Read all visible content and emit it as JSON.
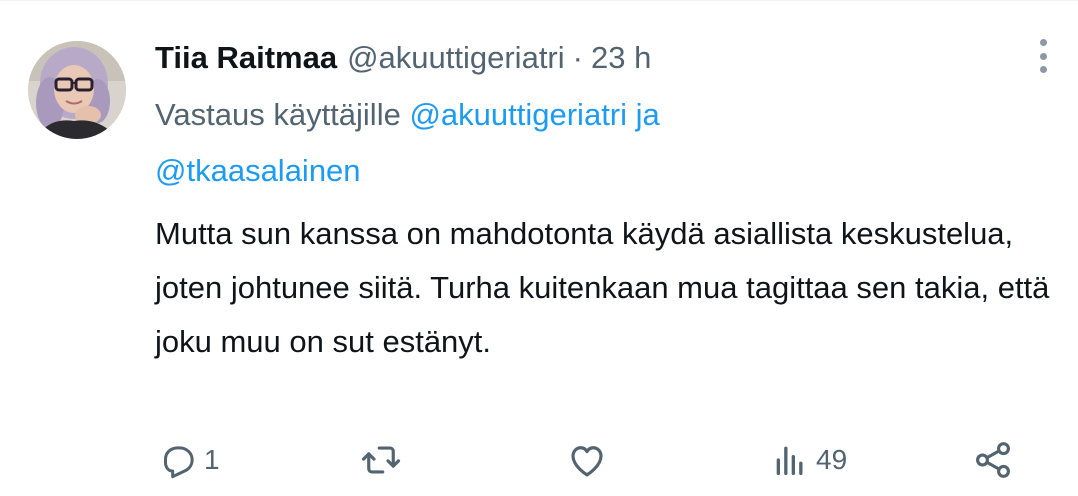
{
  "tweet": {
    "display_name": "Tiia Raitmaa",
    "handle": "@akuuttigeriatri",
    "separator": "·",
    "time": "23 h",
    "reply_prefix": "Vastaus käyttäjille",
    "reply_mention_1": "@akuuttigeriatri ja",
    "reply_mention_2": "@tkaasalainen",
    "text": "Mutta sun kanssa on mahdotonta käydä asiallista keskustelua, joten johtunee siitä. Turha kuitenkaan mua tagittaa sen takia, että joku muu on sut estänyt."
  },
  "actions": {
    "reply_icon": "reply-bubble-icon",
    "reply_count": "1",
    "retweet_icon": "retweet-icon",
    "like_icon": "heart-icon",
    "views_icon": "bar-chart-icon",
    "views_count": "49",
    "share_icon": "share-icon"
  },
  "colors": {
    "text_primary": "#0f1419",
    "text_secondary": "#536471",
    "link": "#1d9bf0"
  }
}
